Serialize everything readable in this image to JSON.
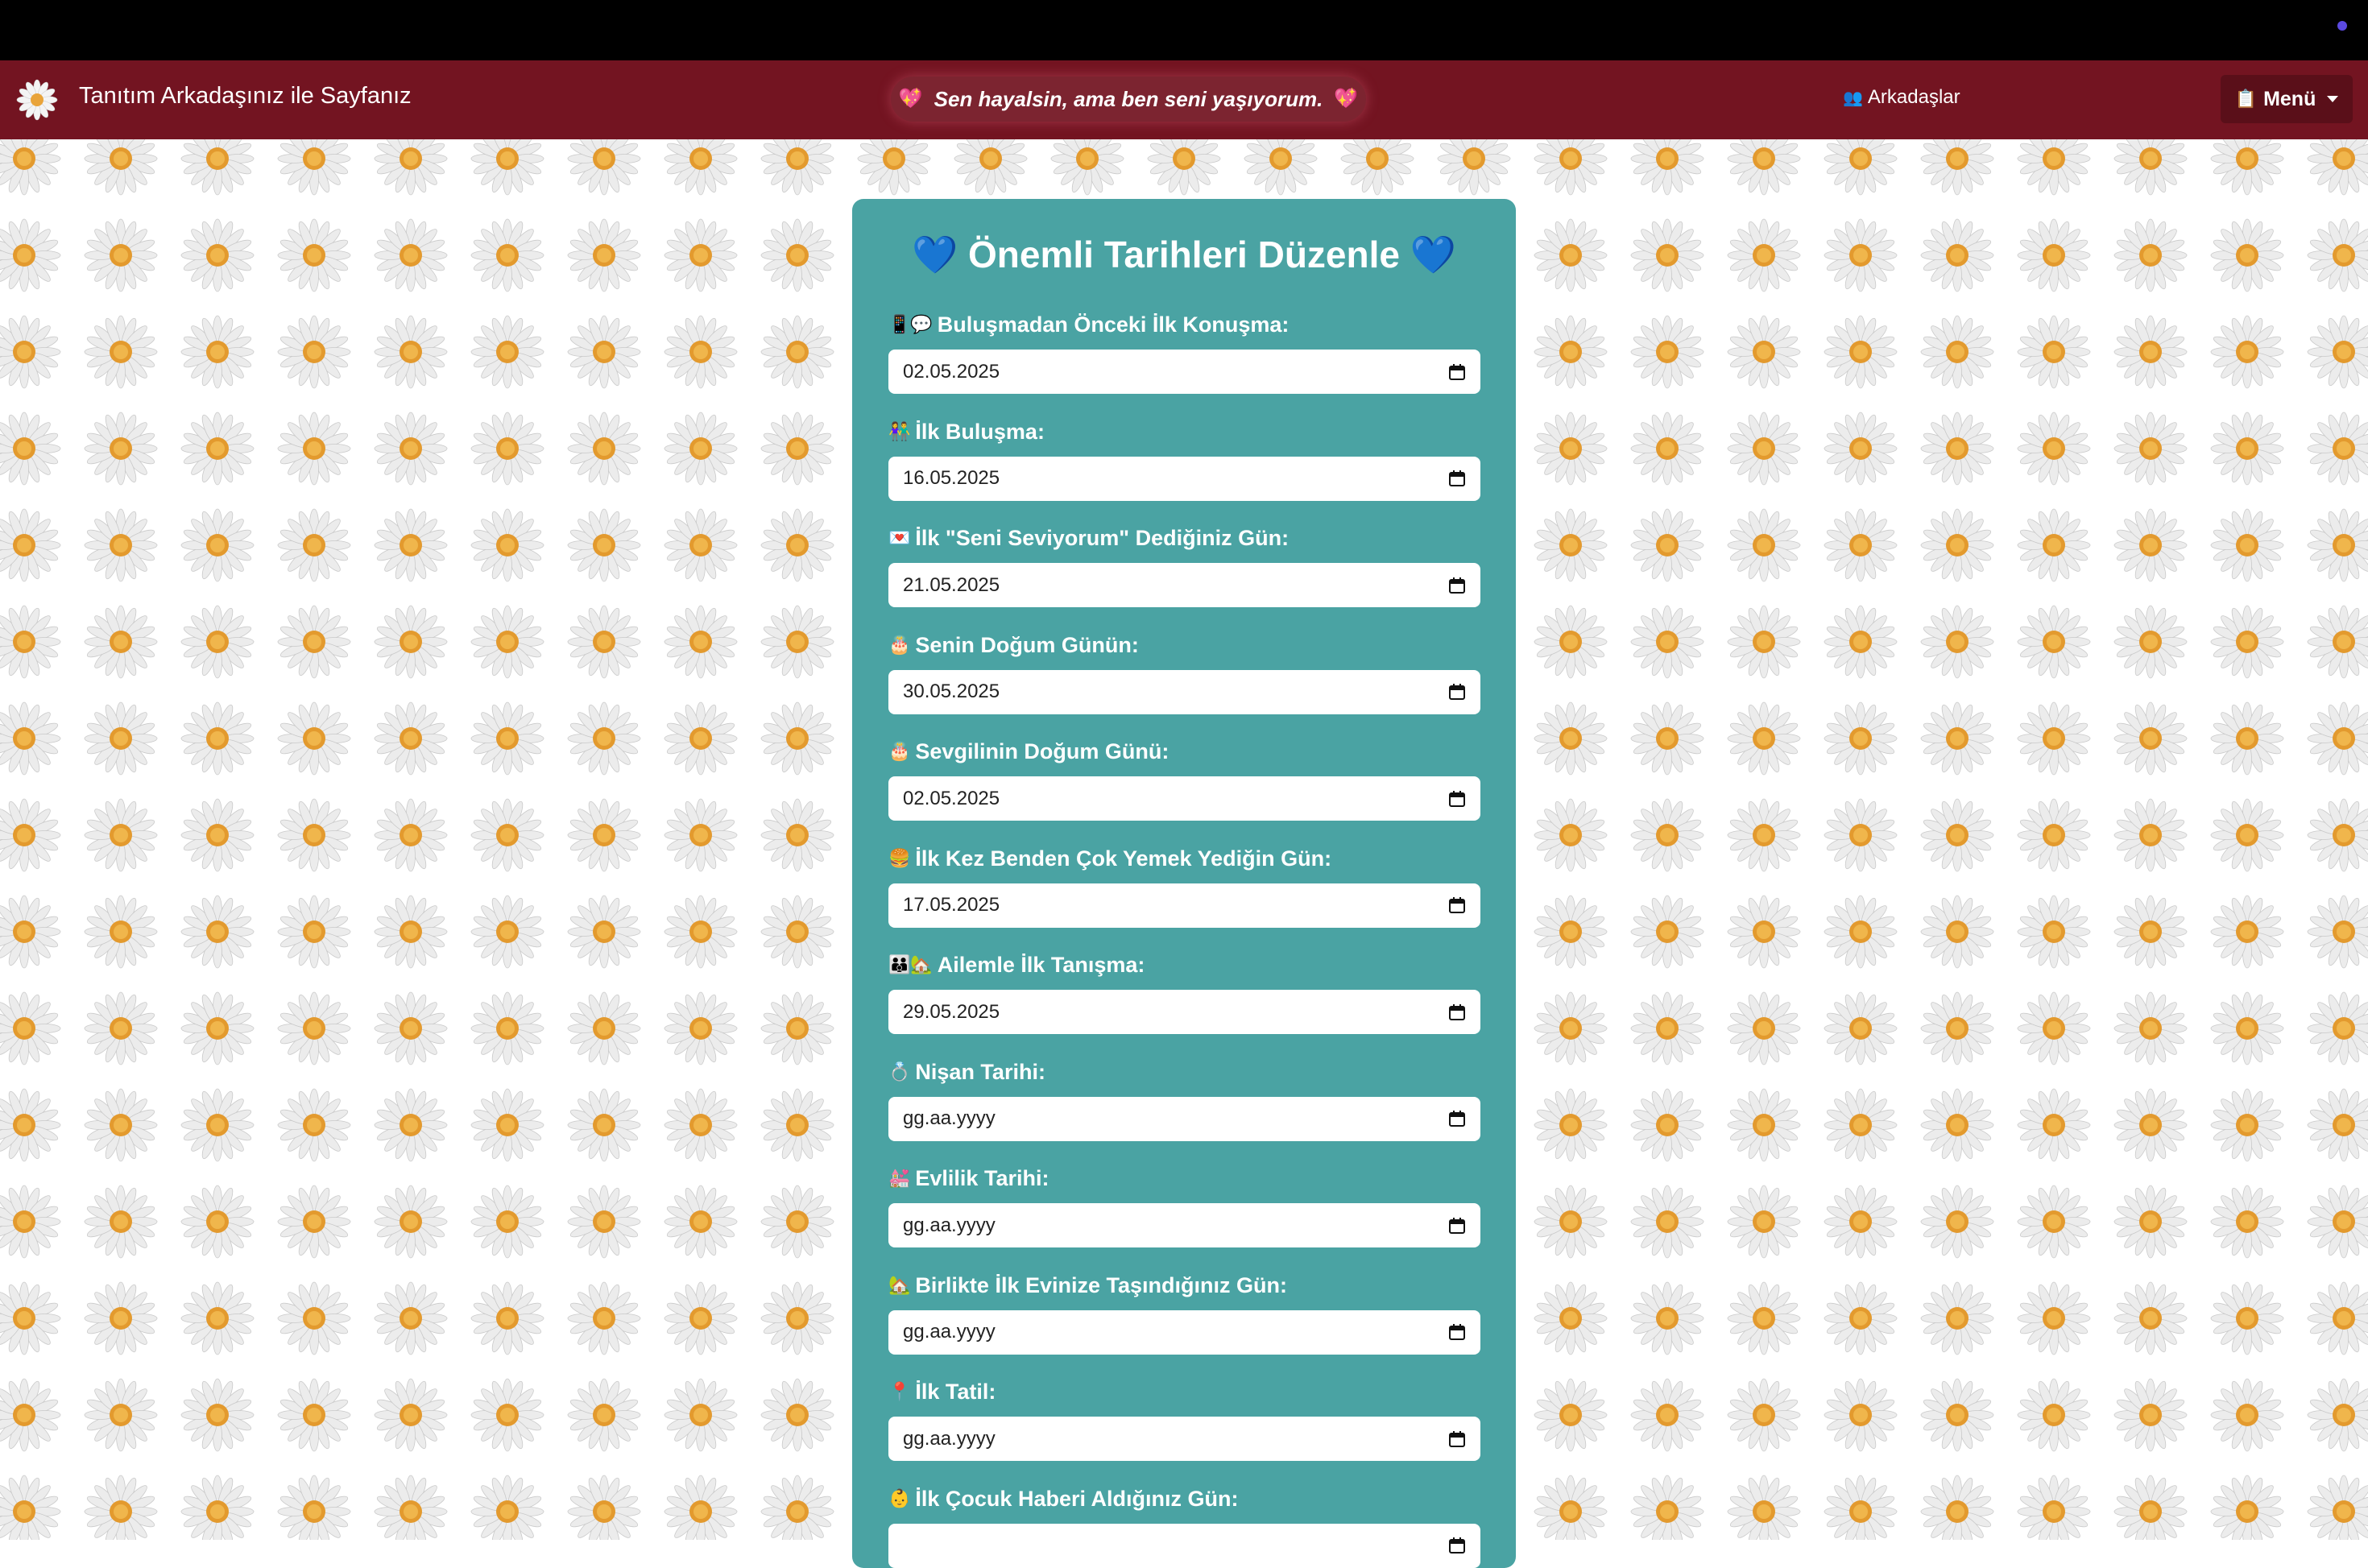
{
  "navbar": {
    "brand": "Tanıtım Arkadaşınız ile Sayfanız",
    "quote": "Sen hayalsin, ama ben seni yaşıyorum.",
    "friends_link": "Arkadaşlar",
    "menu_label": "Menü",
    "colors": {
      "navbar_bg": "#731421",
      "menu_bg": "#5a0f19"
    }
  },
  "card": {
    "title": "Önemli Tarihleri Düzenle",
    "bg_color": "#4aa3a3",
    "fields": [
      {
        "emoji": "📱💬",
        "label": "Buluşmadan Önceki İlk Konuşma:",
        "value": "02.05.2025"
      },
      {
        "emoji": "👫",
        "label": "İlk Buluşma:",
        "value": "16.05.2025"
      },
      {
        "emoji": "💌",
        "label": "İlk \"Seni Seviyorum\" Dediğiniz Gün:",
        "value": "21.05.2025"
      },
      {
        "emoji": "🎂",
        "label": "Senin Doğum Günün:",
        "value": "30.05.2025"
      },
      {
        "emoji": "🎂",
        "label": "Sevgilinin Doğum Günü:",
        "value": "02.05.2025"
      },
      {
        "emoji": "🍔",
        "label": "İlk Kez Benden Çok Yemek Yediğin Gün:",
        "value": "17.05.2025"
      },
      {
        "emoji": "👪🏡",
        "label": "Ailemle İlk Tanışma:",
        "value": "29.05.2025"
      },
      {
        "emoji": "💍",
        "label": "Nişan Tarihi:",
        "value": "gg.aa.yyyy"
      },
      {
        "emoji": "💒",
        "label": "Evlilik Tarihi:",
        "value": "gg.aa.yyyy"
      },
      {
        "emoji": "🏡",
        "label": "Birlikte İlk Evinize Taşındığınız Gün:",
        "value": "gg.aa.yyyy"
      },
      {
        "emoji": "📍",
        "label": "İlk Tatil:",
        "value": "gg.aa.yyyy"
      },
      {
        "emoji": "👶",
        "label": "İlk Çocuk Haberi Aldığınız Gün:",
        "value": ""
      }
    ]
  }
}
